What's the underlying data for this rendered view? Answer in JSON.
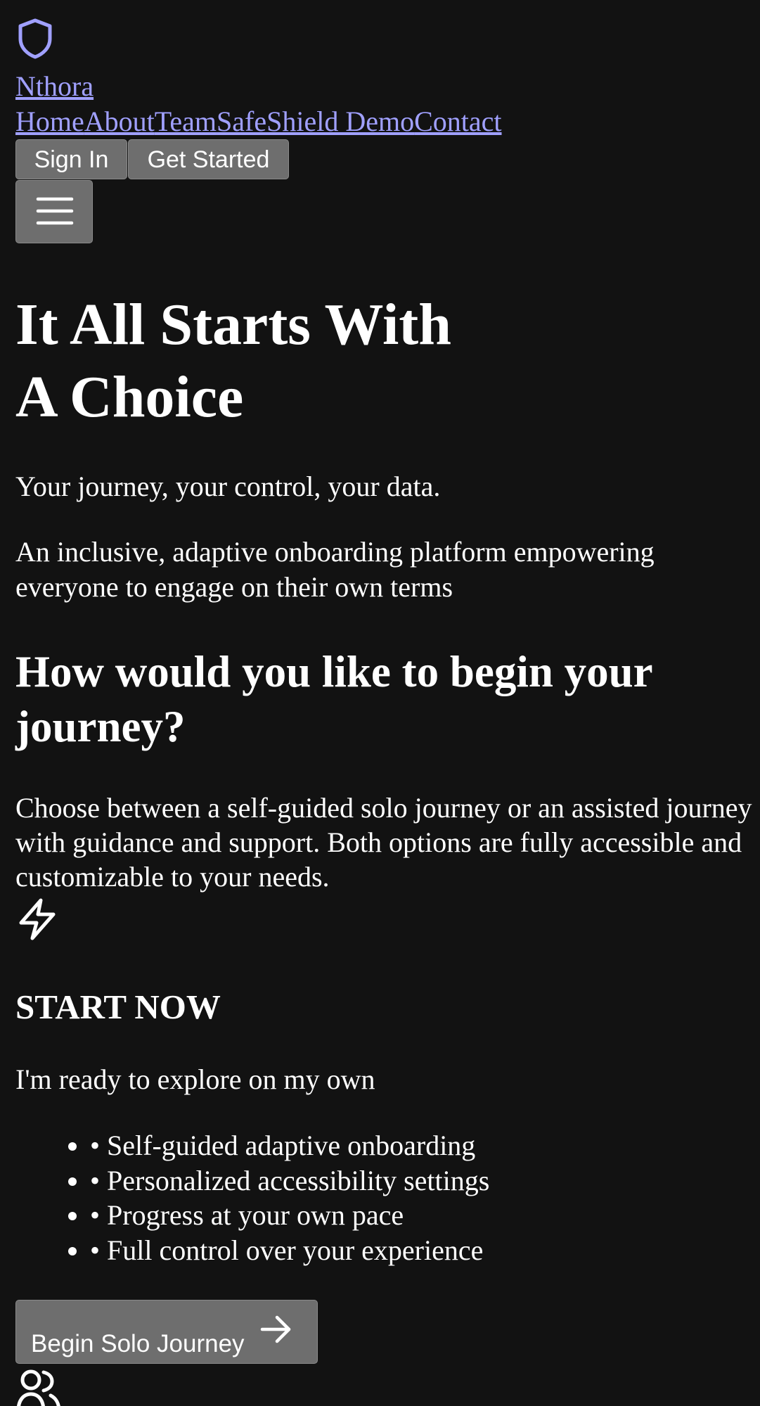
{
  "header": {
    "logo_icon": "shield-icon",
    "brand": "Nthora",
    "nav": [
      "Home",
      "About",
      "Team",
      "SafeShield Demo",
      "Contact"
    ],
    "sign_in": "Sign In",
    "get_started": "Get Started",
    "menu_icon": "menu-icon"
  },
  "hero": {
    "title_line1": "It All Starts With",
    "title_line2": "A Choice",
    "tagline": "Your journey, your control, your data.",
    "description": "An inclusive, adaptive onboarding platform empowering everyone to engage on their own terms"
  },
  "choice": {
    "heading": "How would you like to begin your journey?",
    "text": "Choose between a self-guided solo journey or an assisted journey with guidance and support. Both options are fully accessible and customizable to your needs."
  },
  "solo": {
    "icon": "lightning-icon",
    "heading": "START NOW",
    "subtitle": "I'm ready to explore on my own",
    "features": [
      "• Self-guided adaptive onboarding",
      "• Personalized accessibility settings",
      "• Progress at your own pace",
      "• Full control over your experience"
    ],
    "button": "Begin Solo Journey",
    "button_icon": "arrow-right-icon"
  },
  "assisted": {
    "icon": "users-icon"
  },
  "colors": {
    "background": "#121212",
    "link": "#a0a0ff",
    "button": "#6e6e6e",
    "text": "#ffffff"
  }
}
